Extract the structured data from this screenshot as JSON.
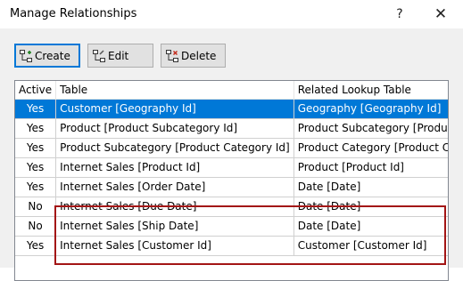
{
  "window": {
    "title": "Manage Relationships",
    "help_glyph": "?",
    "close_glyph": "✕"
  },
  "toolbar": {
    "create_label": "Create",
    "edit_label": "Edit",
    "delete_label": "Delete"
  },
  "grid": {
    "columns": [
      "Active",
      "Table",
      "Related Lookup Table"
    ],
    "rows": [
      {
        "active": "Yes",
        "table": "Customer [Geography Id]",
        "lookup": "Geography [Geography Id]",
        "selected": true
      },
      {
        "active": "Yes",
        "table": "Product [Product Subcategory Id]",
        "lookup": "Product Subcategory [Product Subcatego..."
      },
      {
        "active": "Yes",
        "table": "Product Subcategory [Product Category Id]",
        "lookup": "Product Category [Product Category Id]"
      },
      {
        "active": "Yes",
        "table": "Internet Sales [Product Id]",
        "lookup": "Product [Product Id]"
      },
      {
        "active": "Yes",
        "table": "Internet Sales [Order Date]",
        "lookup": "Date [Date]"
      },
      {
        "active": "No",
        "table": "Internet Sales [Due Date]",
        "lookup": "Date [Date]"
      },
      {
        "active": "No",
        "table": "Internet Sales [Ship Date]",
        "lookup": "Date [Date]"
      },
      {
        "active": "Yes",
        "table": "Internet Sales [Customer Id]",
        "lookup": "Customer [Customer Id]"
      }
    ]
  },
  "colors": {
    "selection": "#0078d7",
    "highlight_border": "#a31515"
  }
}
